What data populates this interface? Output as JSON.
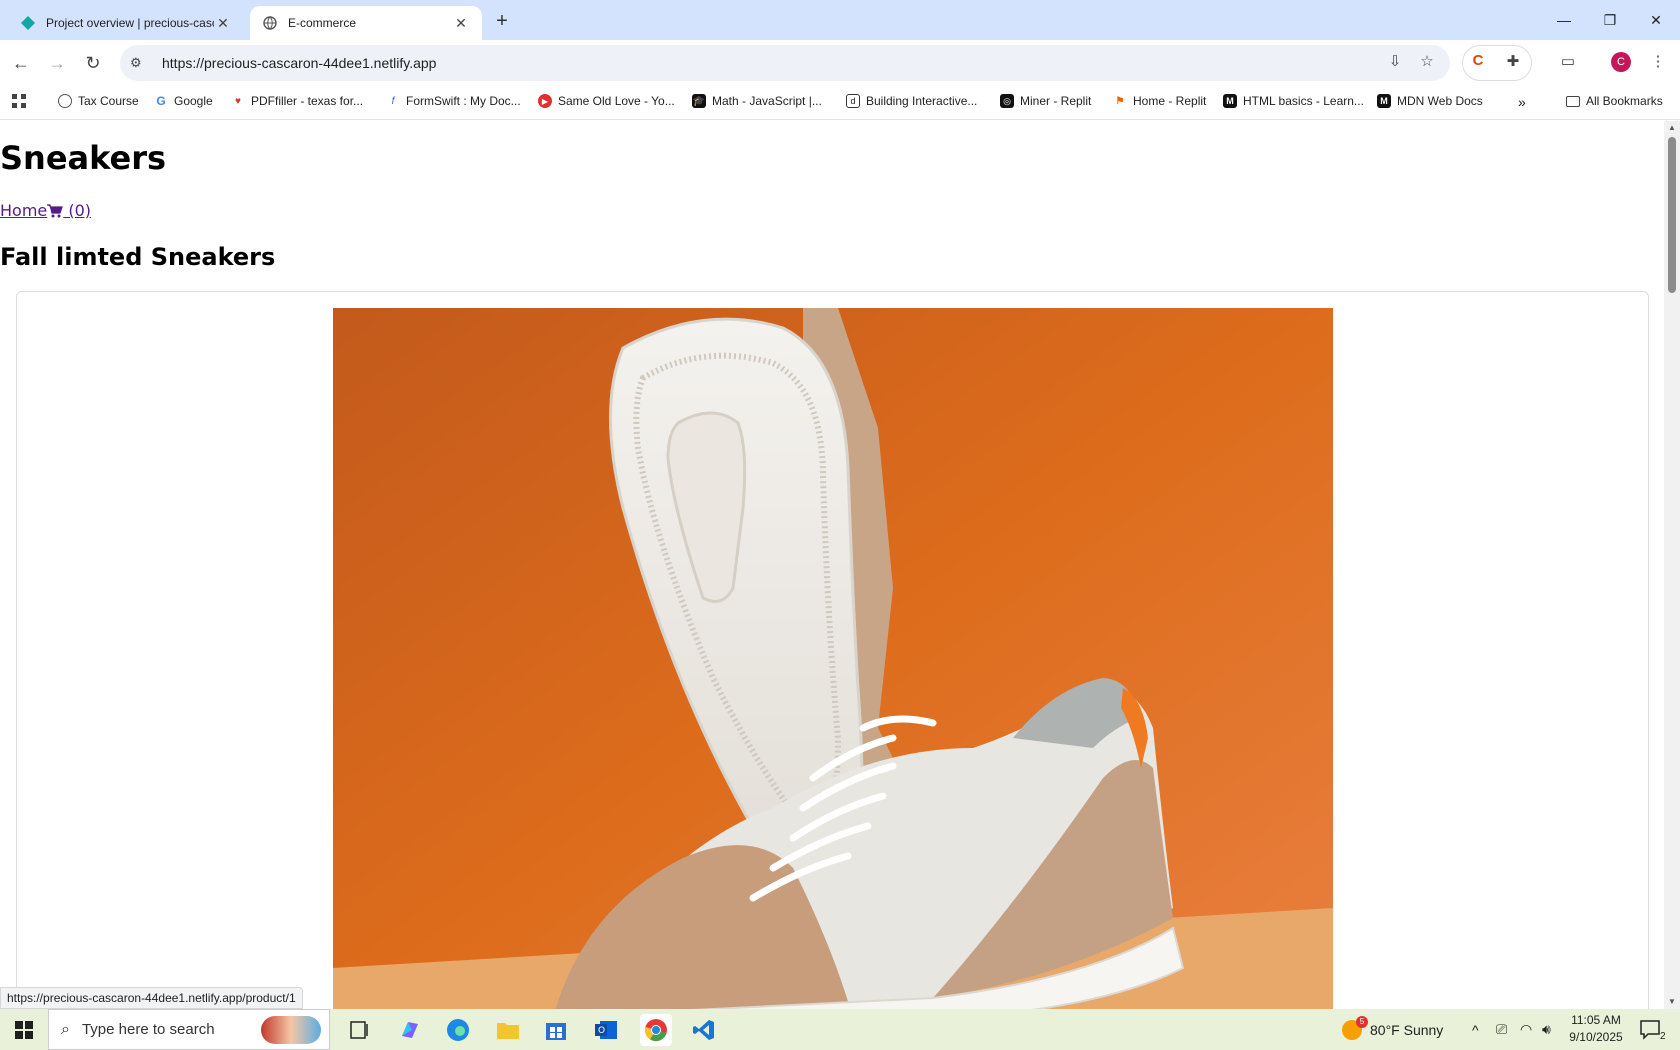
{
  "browser": {
    "tabs": [
      {
        "label": "Project overview | precious-cascaron",
        "active": false
      },
      {
        "label": "E-commerce",
        "active": true
      }
    ],
    "url": "https://precious-cascaron-44dee1.netlify.app",
    "avatar_letter": "C",
    "status_url": "https://precious-cascaron-44dee1.netlify.app/product/1"
  },
  "bookmarks": {
    "items": [
      {
        "label": "Tax Course",
        "icon": "globe-icon"
      },
      {
        "label": "Google",
        "icon": "google-icon"
      },
      {
        "label": "PDFfiller - texas for...",
        "icon": "pdffiller-icon"
      },
      {
        "label": "FormSwift : My Doc...",
        "icon": "formswift-icon"
      },
      {
        "label": "Same Old Love - Yo...",
        "icon": "youtube-icon"
      },
      {
        "label": "Math - JavaScript |...",
        "icon": "graduation-cap-icon"
      },
      {
        "label": "Building Interactive...",
        "icon": "doc-icon"
      },
      {
        "label": "Miner - Replit",
        "icon": "replit-icon"
      },
      {
        "label": "Home - Replit",
        "icon": "replit-orange-icon"
      },
      {
        "label": "HTML basics - Learn...",
        "icon": "mdn-icon"
      },
      {
        "label": "MDN Web Docs",
        "icon": "mdn-icon"
      }
    ],
    "all_bookmarks": "All Bookmarks"
  },
  "page": {
    "title": "Sneakers",
    "nav": {
      "home": "Home",
      "cart_count": " (0)"
    },
    "section_title": "Fall limted Sneakers",
    "product_image": "sneaker-photo"
  },
  "taskbar": {
    "search_placeholder": "Type here to search",
    "weather": "80°F  Sunny",
    "weather_badge": "5",
    "time": "11:05 AM",
    "date": "9/10/2025",
    "notifications": "2"
  },
  "colors": {
    "tabstrip": "#d3e3fd",
    "link": "#551a8b",
    "photo_bg": "#d96a1f",
    "taskbar": "#e9f2d8"
  }
}
